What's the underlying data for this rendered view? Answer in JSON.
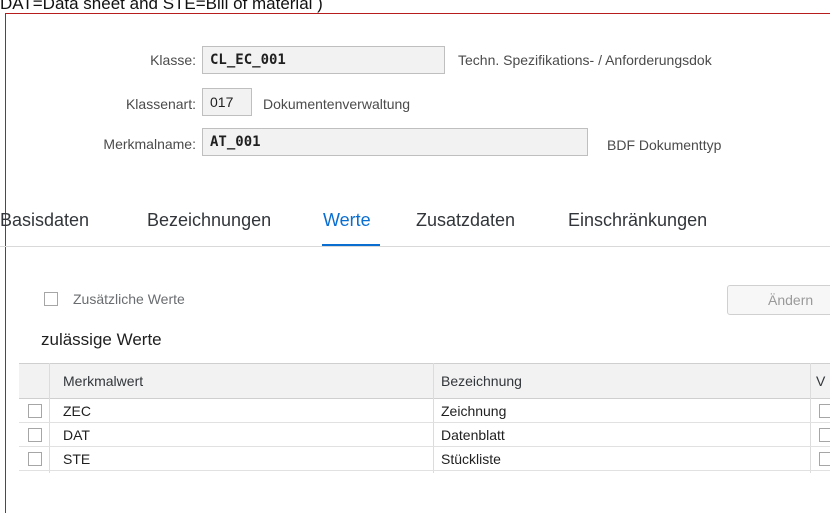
{
  "caption": "DAT=Data sheet  and STE=Bill of material )",
  "header": {
    "klasse_label": "Klasse:",
    "klasse_value": "CL_EC_001",
    "klasse_desc": "Techn. Spezifikations- / Anforderungsdok",
    "klassenart_label": "Klassenart:",
    "klassenart_value": "017",
    "klassenart_desc": "Dokumentenverwaltung",
    "merkmalname_label": "Merkmalname:",
    "merkmalname_value": "AT_001",
    "merkmalname_desc": "BDF Dokumenttyp"
  },
  "tabs": [
    {
      "label": "Basisdaten"
    },
    {
      "label": "Bezeichnungen"
    },
    {
      "label": "Werte"
    },
    {
      "label": "Zusatzdaten"
    },
    {
      "label": "Einschränkungen"
    }
  ],
  "active_tab": "Werte",
  "options": {
    "zusaetzliche_werte_label": "Zusätzliche Werte",
    "zusaetzliche_werte_checked": false,
    "aendern_button": "Ändern"
  },
  "section_title": "zulässige Werte",
  "table": {
    "columns": [
      "Merkmalwert",
      "Bezeichnung",
      "V"
    ],
    "rows": [
      {
        "value": "ZEC",
        "description": "Zeichnung"
      },
      {
        "value": "DAT",
        "description": "Datenblatt"
      },
      {
        "value": "STE",
        "description": "Stückliste"
      }
    ]
  }
}
